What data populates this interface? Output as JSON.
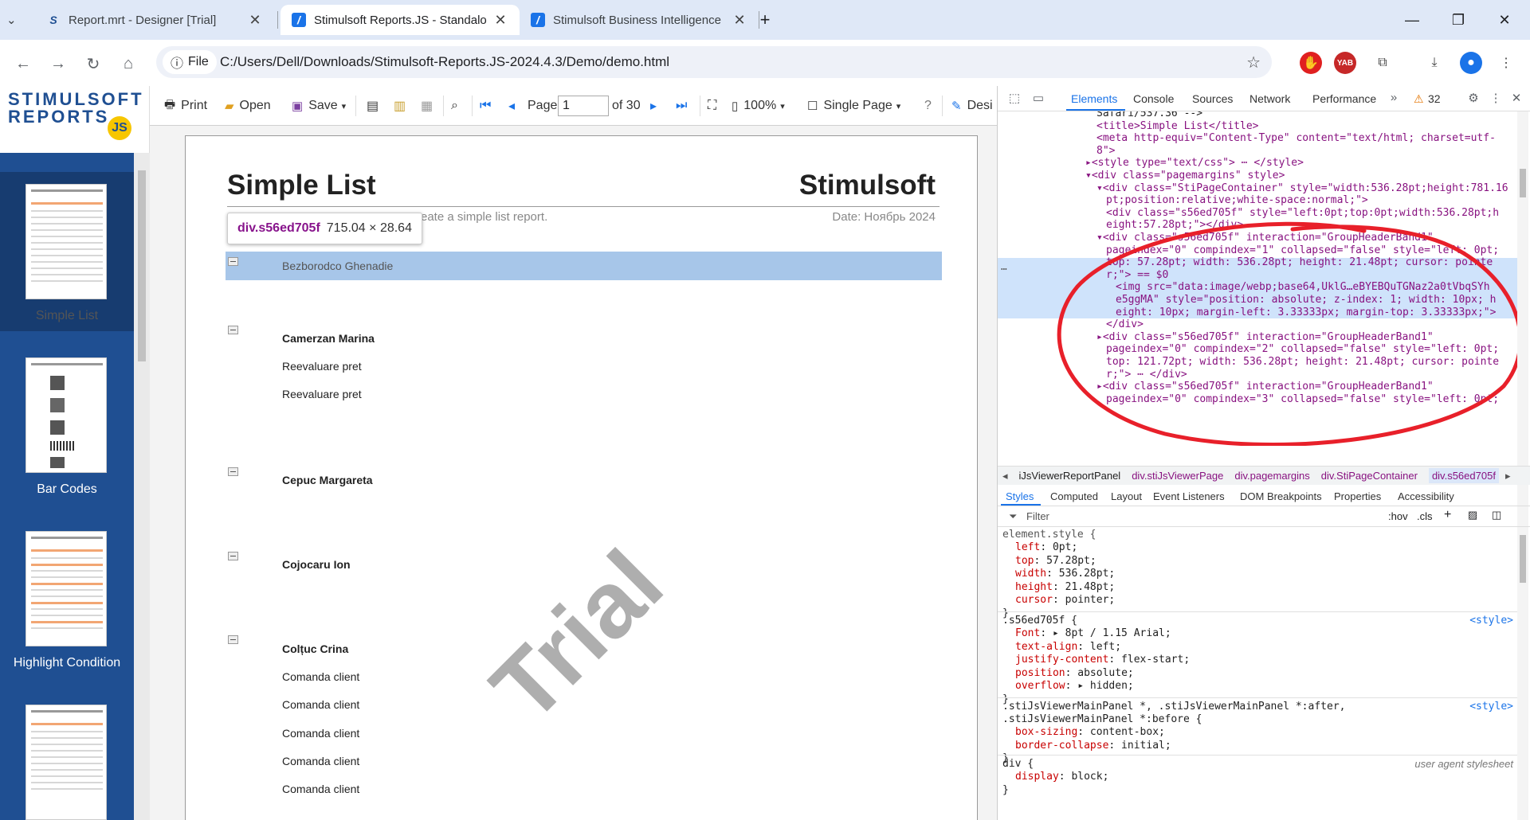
{
  "browser": {
    "tabs": [
      {
        "title": "Report.mrt - Designer [Trial]",
        "icon": "stimulsoft-s-icon"
      },
      {
        "title": "Stimulsoft Reports.JS - Standalo",
        "icon": "stimulsoft-slash-icon"
      },
      {
        "title": "Stimulsoft Business Intelligence",
        "icon": "stimulsoft-slash-icon"
      }
    ],
    "new_tab": "+",
    "file_chip": "File",
    "url": "C:/Users/Dell/Downloads/Stimulsoft-Reports.JS-2024.4.3/Demo/demo.html",
    "ext_badge": "YAB"
  },
  "sidebar": {
    "logo_line1": "STIMULSOFT",
    "logo_line2": "REPORTS",
    "logo_badge": "JS",
    "thumbnails": [
      {
        "label": "Simple List"
      },
      {
        "label": "Bar Codes"
      },
      {
        "label": "Highlight Condition"
      }
    ]
  },
  "viewer_toolbar": {
    "print": "Print",
    "open": "Open",
    "save": "Save",
    "page_label": "Page",
    "page_value": "1",
    "page_of": "of 30",
    "zoom": "100%",
    "view_mode": "Single Page",
    "help": "?",
    "design": "Desi"
  },
  "report": {
    "title": "Simple List",
    "brand": "Stimulsoft",
    "subtitle": "reate a simple list report.",
    "date": "Date: Ноябрь 2024",
    "highlighted_group": "Bezborodco Ghenadie",
    "groups": [
      {
        "name": "Camerzan Marina",
        "items": [
          "Reevaluare pret",
          "Reevaluare pret"
        ]
      },
      {
        "name": "Cepuc Margareta",
        "items": []
      },
      {
        "name": "Cojocaru Ion",
        "items": []
      },
      {
        "name": "Colțuc Crina",
        "items": [
          "Comanda client",
          "Comanda client",
          "Comanda client",
          "Comanda client",
          "Comanda client"
        ]
      }
    ],
    "watermark": "Trial"
  },
  "inspect_tooltip": {
    "name": "div.s56ed705f",
    "dims": "715.04 × 28.64"
  },
  "devtools": {
    "tabs": [
      "Elements",
      "Console",
      "Sources",
      "Network",
      "Performance"
    ],
    "warning_count": "32",
    "dom_lines": [
      {
        "text": "Safari/537.36 -->",
        "cls": "tx",
        "indent": 1
      },
      {
        "text": "<title>Simple List</title>",
        "cls": "tg",
        "indent": 1
      },
      {
        "text": "<meta http-equiv=\"Content-Type\" content=\"text/html; charset=utf-",
        "cls": "tg",
        "indent": 1
      },
      {
        "text": "8\">",
        "cls": "tg",
        "indent": 1
      },
      {
        "text": "▸<style type=\"text/css\"> ⋯ </style>",
        "cls": "tg",
        "indent": 0
      },
      {
        "text": "▾<div class=\"pagemargins\" style>",
        "cls": "tg",
        "indent": 0
      },
      {
        "text": "▾<div class=\"StiPageContainer\" style=\"width:536.28pt;height:781.16",
        "cls": "tg",
        "indent": 1
      },
      {
        "text": "pt;position:relative;white-space:normal;\">",
        "cls": "tg",
        "indent": 2
      },
      {
        "text": "<div class=\"s56ed705f\" style=\"left:0pt;top:0pt;width:536.28pt;h",
        "cls": "tg",
        "indent": 2
      },
      {
        "text": "eight:57.28pt;\"></div>",
        "cls": "tg",
        "indent": 2
      },
      {
        "text": "▾<div class=\"s56ed705f\" interaction=\"GroupHeaderBand1\"",
        "cls": "tg",
        "indent": 1
      },
      {
        "text": "pageindex=\"0\" compindex=\"1\" collapsed=\"false\" style=\"left: 0pt;",
        "cls": "tg",
        "indent": 2
      },
      {
        "text": "top: 57.28pt; width: 536.28pt; height: 21.48pt; cursor: pointe",
        "cls": "tg",
        "indent": 2
      },
      {
        "text": "r;\"> == $0",
        "cls": "tg",
        "indent": 2
      },
      {
        "text": "<img src=\"data:image/webp;base64,UklG…eBYEBQuTGNaz2a0tVbqSYh",
        "cls": "tg",
        "indent": 3
      },
      {
        "text": "e5ggMA\" style=\"position: absolute; z-index: 1; width: 10px; h",
        "cls": "tg",
        "indent": 3
      },
      {
        "text": "eight: 10px; margin-left: 3.33333px; margin-top: 3.33333px;\">",
        "cls": "tg",
        "indent": 3
      },
      {
        "text": "</div>",
        "cls": "tg",
        "indent": 2
      },
      {
        "text": "▸<div class=\"s56ed705f\" interaction=\"GroupHeaderBand1\"",
        "cls": "tg",
        "indent": 1
      },
      {
        "text": "pageindex=\"0\" compindex=\"2\" collapsed=\"false\" style=\"left: 0pt;",
        "cls": "tg",
        "indent": 2
      },
      {
        "text": "top: 121.72pt; width: 536.28pt; height: 21.48pt; cursor: pointe",
        "cls": "tg",
        "indent": 2
      },
      {
        "text": "r;\"> ⋯ </div>",
        "cls": "tg",
        "indent": 2
      },
      {
        "text": "▸<div class=\"s56ed705f\" interaction=\"GroupHeaderBand1\"",
        "cls": "tg",
        "indent": 1
      },
      {
        "text": "pageindex=\"0\" compindex=\"3\" collapsed=\"false\" style=\"left: 0pt;",
        "cls": "tg",
        "indent": 2
      }
    ],
    "breadcrumbs": [
      "iJsViewerReportPanel",
      "div.stiJsViewerPage",
      "div.pagemargins",
      "div.StiPageContainer",
      "div.s56ed705f"
    ],
    "subtabs": [
      "Styles",
      "Computed",
      "Layout",
      "Event Listeners",
      "DOM Breakpoints",
      "Properties",
      "Accessibility"
    ],
    "filter_placeholder": "Filter",
    "filter_hov": ":hov",
    "filter_cls": ".cls",
    "element_style": {
      "selector": "element.style {",
      "props": [
        [
          "left",
          "0pt;"
        ],
        [
          "top",
          "57.28pt;"
        ],
        [
          "width",
          "536.28pt;"
        ],
        [
          "height",
          "21.48pt;"
        ],
        [
          "cursor",
          "pointer;"
        ]
      ]
    },
    "rule1": {
      "selector": ".s56ed705f {",
      "source": "<style>",
      "props": [
        [
          "Font",
          "▸ 8pt / 1.15 Arial;"
        ],
        [
          "text-align",
          "left;"
        ],
        [
          "justify-content",
          "flex-start;"
        ],
        [
          "position",
          "absolute;"
        ],
        [
          "overflow",
          "▸ hidden;"
        ]
      ]
    },
    "rule2": {
      "selector": ".stiJsViewerMainPanel *, .stiJsViewerMainPanel *:after,",
      "selector2": ".stiJsViewerMainPanel *:before {",
      "source": "<style>",
      "props": [
        [
          "box-sizing",
          "content-box;"
        ],
        [
          "border-collapse",
          "initial;"
        ]
      ]
    },
    "rule3": {
      "selector": "div {",
      "source": "user agent stylesheet",
      "props": [
        [
          "display",
          "block;"
        ]
      ]
    }
  }
}
